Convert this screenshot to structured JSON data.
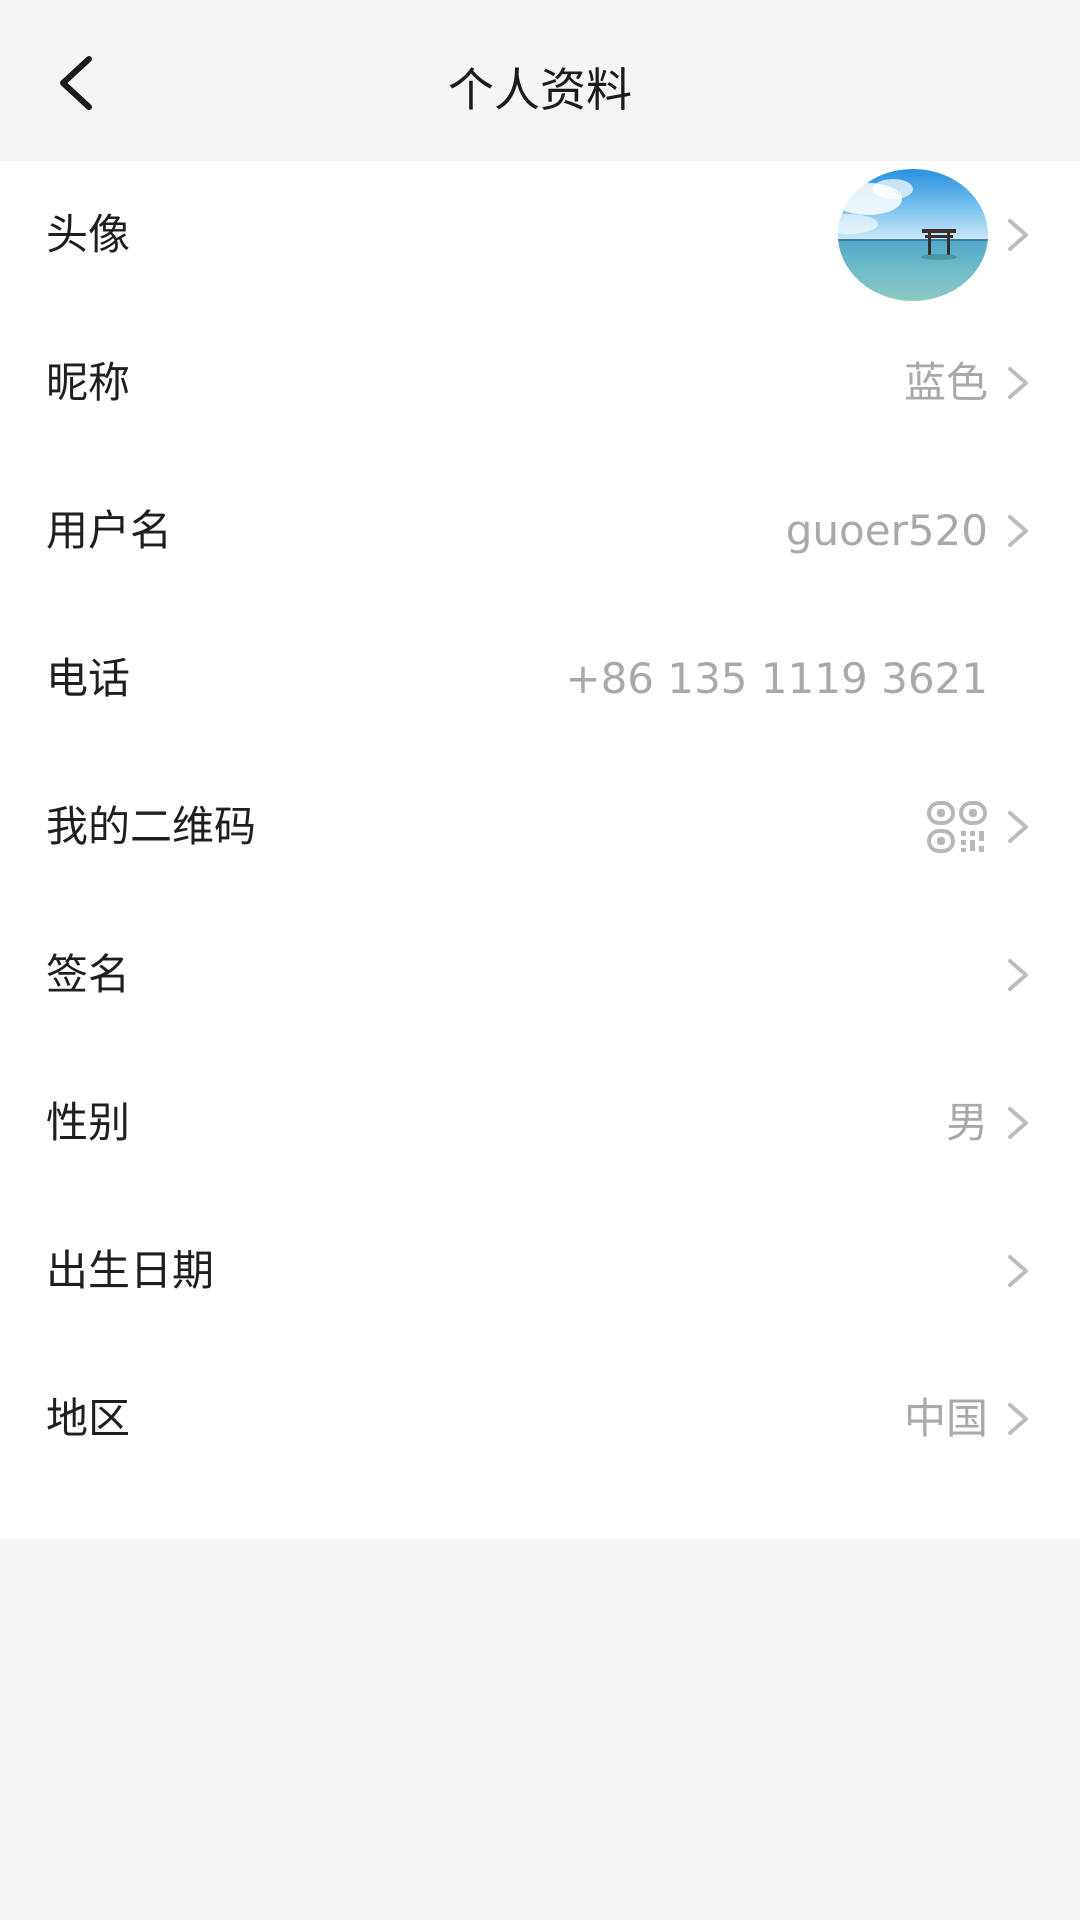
{
  "header": {
    "title": "个人资料",
    "back_icon": "chevron-left-icon"
  },
  "profile": {
    "rows": [
      {
        "key": "avatar",
        "label": "头像",
        "value": "",
        "icon": "avatar-image",
        "has_chevron": true
      },
      {
        "key": "nickname",
        "label": "昵称",
        "value": "蓝色",
        "has_chevron": true
      },
      {
        "key": "username",
        "label": "用户名",
        "value": "guoer520",
        "has_chevron": true
      },
      {
        "key": "phone",
        "label": "电话",
        "value": "+86 135 1119 3621",
        "has_chevron": false
      },
      {
        "key": "qrcode",
        "label": "我的二维码",
        "value": "",
        "icon": "qr-code-icon",
        "has_chevron": true
      },
      {
        "key": "signature",
        "label": "签名",
        "value": "",
        "has_chevron": true
      },
      {
        "key": "gender",
        "label": "性别",
        "value": "男",
        "has_chevron": true
      },
      {
        "key": "birthday",
        "label": "出生日期",
        "value": "",
        "has_chevron": true
      },
      {
        "key": "region",
        "label": "地区",
        "value": "中国",
        "has_chevron": true
      }
    ]
  },
  "colors": {
    "background": "#f5f5f5",
    "card": "#ffffff",
    "label": "#1f1f1f",
    "value": "#a9a9a9",
    "chevron": "#bdbdbd"
  }
}
